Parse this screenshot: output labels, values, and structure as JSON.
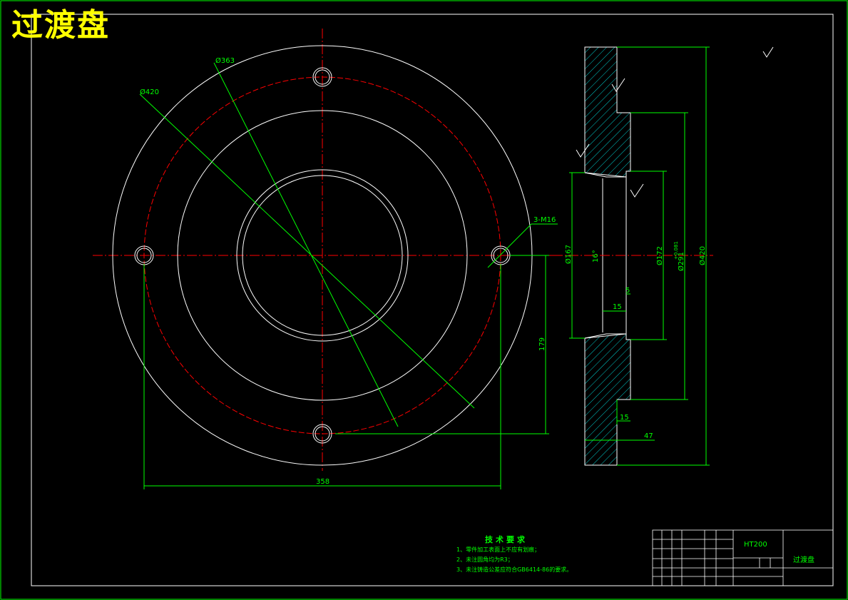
{
  "drawing": {
    "title": "过渡盘",
    "material": "HT200",
    "part_name": "过渡盘"
  },
  "front_view": {
    "dims": {
      "d363": "Ø363",
      "d420": "Ø420",
      "holes": "3-M16",
      "h179": "179",
      "w358": "358"
    }
  },
  "side_view": {
    "dims": {
      "d167": "Ø167",
      "angle": "16°",
      "d172": "Ø172",
      "d291": "Ø291",
      "d291_tol": "+0.081",
      "d420": "Ø420",
      "w5": "5",
      "w15a": "15",
      "w15b": "15",
      "w47": "47"
    }
  },
  "tech_req": {
    "heading": "技术要求",
    "items": [
      "1、零件加工表面上不应有划痕；",
      "2、未注圆角均为R3；",
      "3、未注铸造公差应符合GB6414-86的要求。"
    ]
  },
  "colors": {
    "line": "#ffffff",
    "dim": "#00ff00",
    "center": "#ff0000",
    "hatch": "#00cccc",
    "title": "#ffff00"
  }
}
